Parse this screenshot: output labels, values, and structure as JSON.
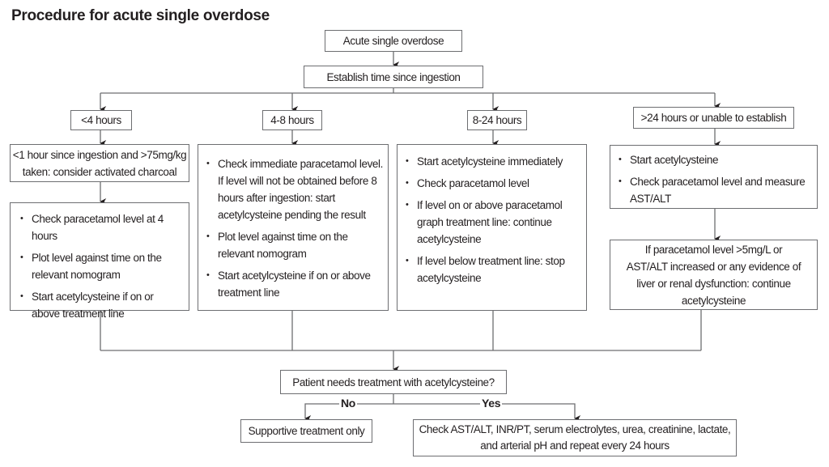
{
  "title": "Procedure for acute single overdose",
  "start": "Acute single overdose",
  "establish": "Establish time since ingestion",
  "columns": [
    {
      "header": "<4 hours",
      "pre_step": "<1 hour since ingestion and >75mg/kg taken: consider activated charcoal",
      "steps": [
        "Check paracetamol level at 4 hours",
        "Plot level against time on the relevant nomogram",
        "Start acetylcysteine if on or above treatment line"
      ]
    },
    {
      "header": "4-8 hours",
      "steps": [
        "Check immediate paracetamol level. If level will not be obtained before 8 hours after ingestion: start acetylcysteine pending the result",
        "Plot level against time on the relevant nomogram",
        "Start acetylcysteine if on or above treatment line"
      ]
    },
    {
      "header": "8-24 hours",
      "steps": [
        "Start acetylcysteine immediately",
        "Check paracetamol level",
        "If level on or above paracetamol graph treatment line: continue acetylcysteine",
        "If level below treatment line: stop acetylcysteine"
      ]
    },
    {
      "header": ">24 hours or unable to establish",
      "steps": [
        "Start acetylcysteine",
        "Check paracetamol level and measure AST/ALT"
      ],
      "post_step": "If paracetamol level >5mg/L or AST/ALT increased or any evidence of liver or renal dysfunction: continue acetylcysteine"
    }
  ],
  "decision": {
    "question": "Patient needs treatment with acetylcysteine?",
    "no_label": "No",
    "yes_label": "Yes",
    "no_outcome": "Supportive treatment only",
    "yes_outcome": "Check AST/ALT, INR/PT, serum electrolytes, urea, creatinine, lactate, and arterial pH and repeat every 24 hours"
  },
  "colors": {
    "line": "#6d6e71",
    "text": "#231f20"
  }
}
